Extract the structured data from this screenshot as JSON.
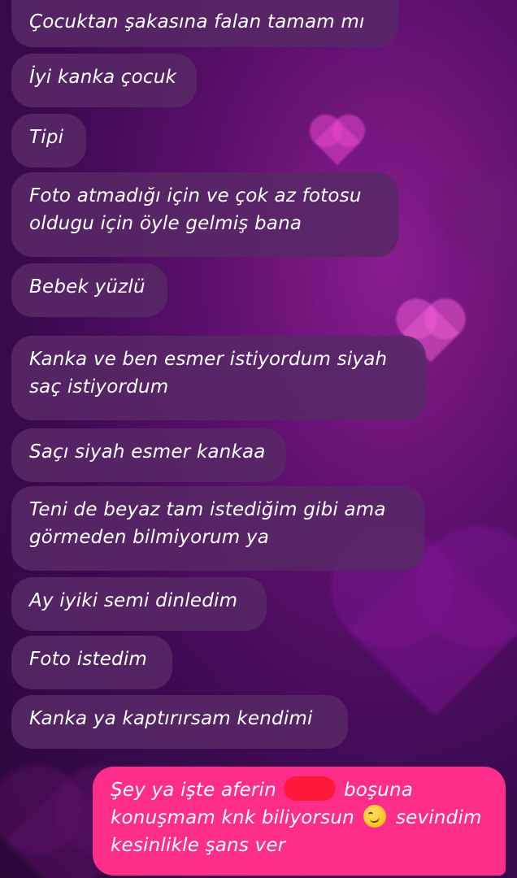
{
  "messages": [
    {
      "text": "Çocuktan şakasına falan tamam mı",
      "from": "other"
    },
    {
      "text": "İyi kanka çocuk",
      "from": "other"
    },
    {
      "text": "Tipi",
      "from": "other"
    },
    {
      "text": "Foto atmadığı için ve çok az fotosu oldugu için öyle gelmiş bana",
      "from": "other"
    },
    {
      "text": "Bebek yüzlü",
      "from": "other"
    },
    {
      "text": "Kanka ve ben esmer istiyordum siyah saç istiyordum",
      "from": "other"
    },
    {
      "text": "Saçı siyah esmer kankaa",
      "from": "other"
    },
    {
      "text": "Teni de beyaz tam istediğim gibi ama görmeden bilmiyorum ya",
      "from": "other"
    },
    {
      "text": "Ay iyiki semi dinledim",
      "from": "other"
    },
    {
      "text": "Foto istedim",
      "from": "other"
    },
    {
      "text": "Kanka ya kaptırırsam kendimi",
      "from": "other"
    },
    {
      "from": "me",
      "part1": "Şey ya işte aferin",
      "part2": "boşuna konuşmam knk biliyorsun",
      "emoji": "smirk-emoji",
      "part3": "sevindim kesinlikle şans ver"
    }
  ],
  "colors": {
    "received_bubble": "#582866",
    "sent_bubble": "#ff2d8a",
    "background": "#5a0f6b",
    "redaction": "#ff1a3c"
  }
}
